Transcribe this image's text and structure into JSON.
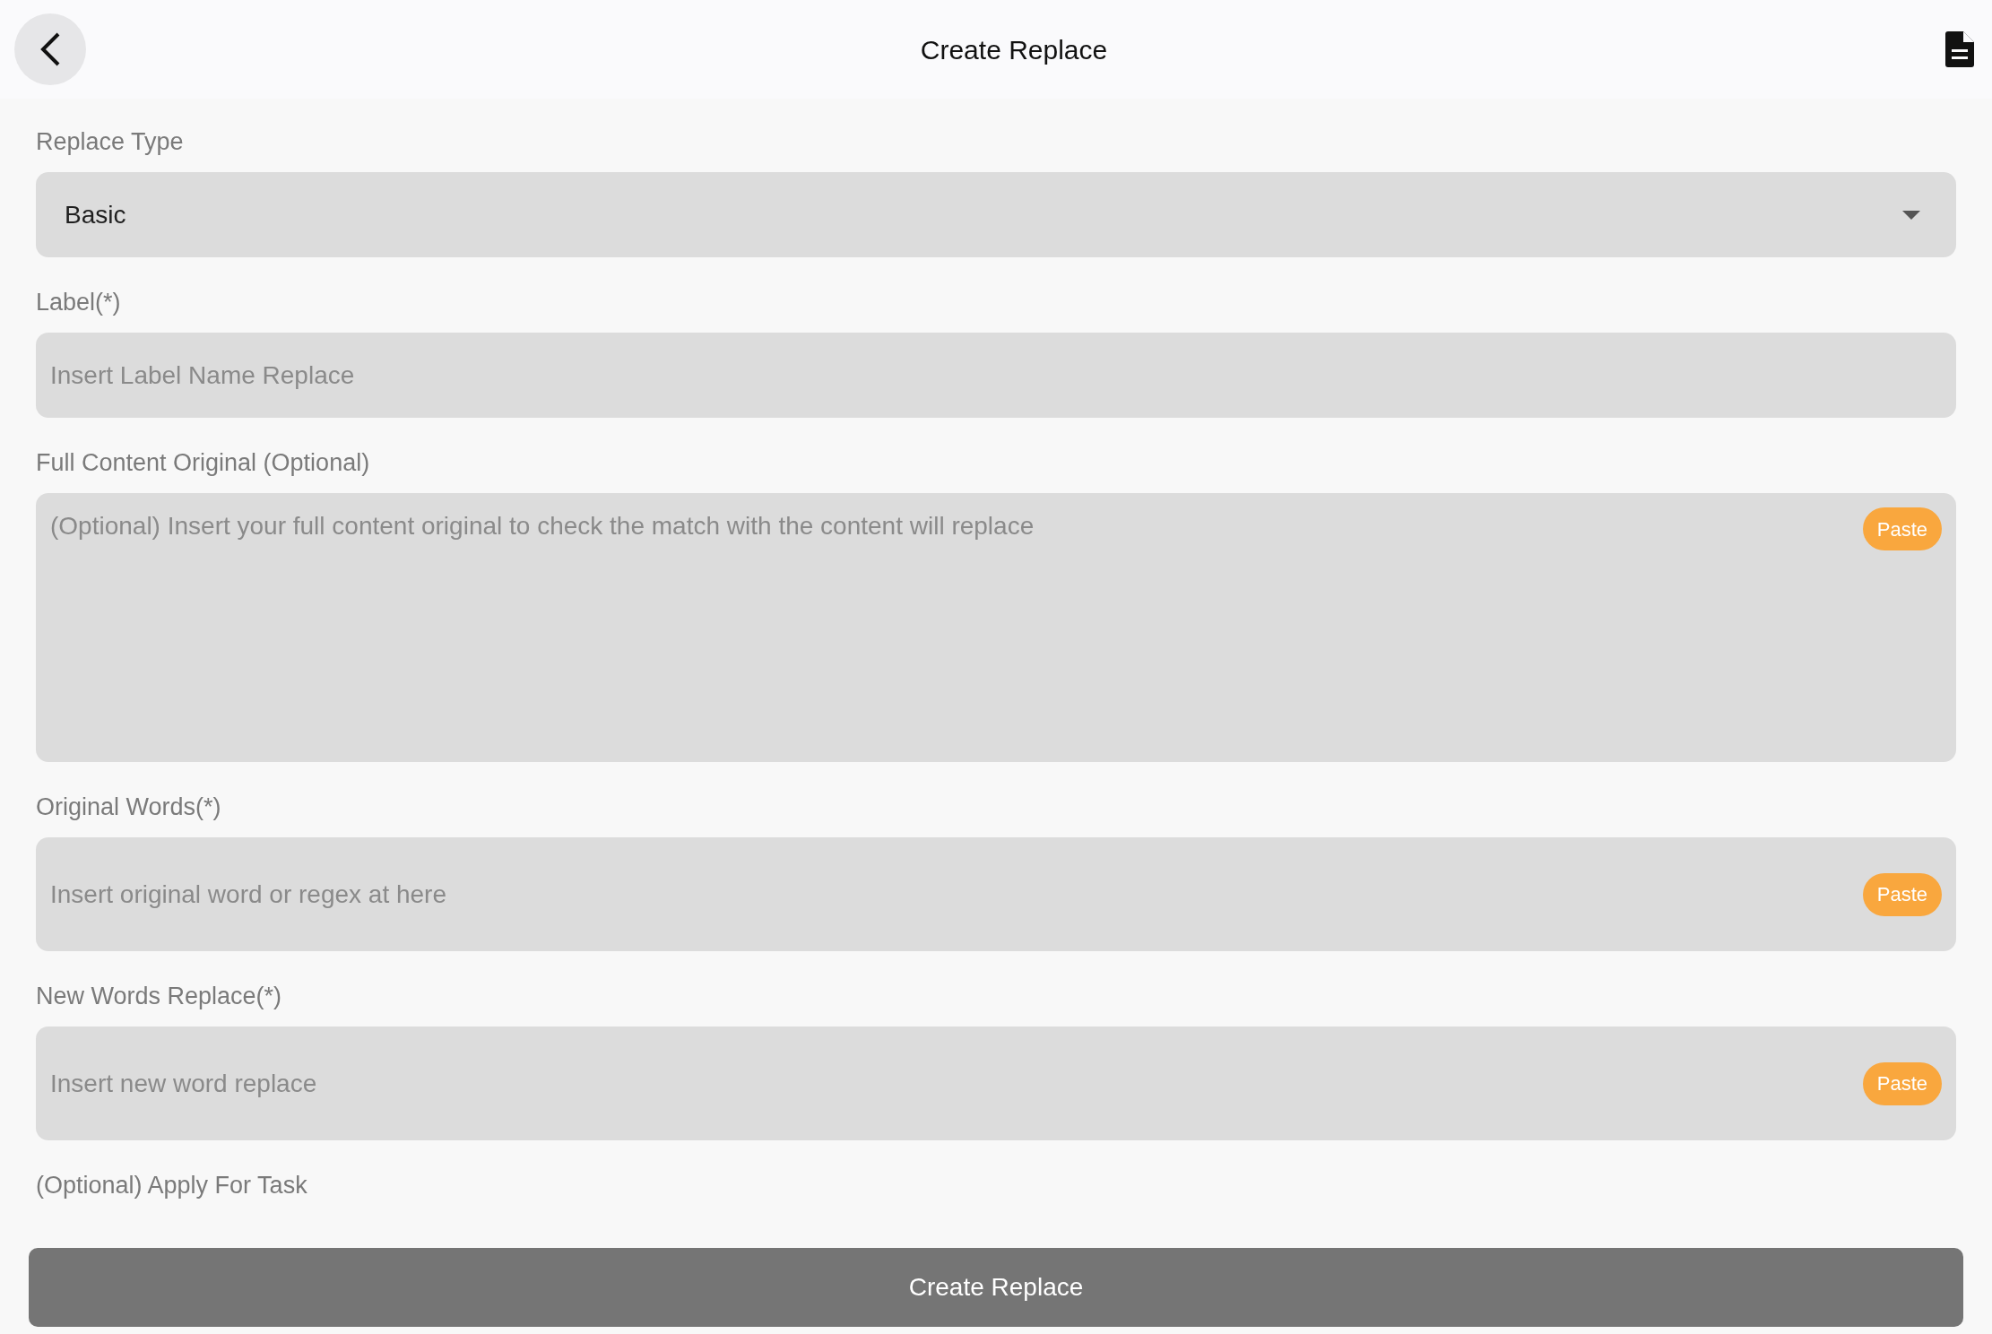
{
  "header": {
    "title": "Create Replace"
  },
  "fields": [
    {
      "kind": "select",
      "label": "Replace Type",
      "value": "Basic"
    },
    {
      "kind": "input",
      "label": "Label(*)",
      "placeholder": "Insert Label Name Replace"
    },
    {
      "kind": "textarea",
      "label": "Full Content Original (Optional)",
      "placeholder": "(Optional) Insert your full content original to check the match with the content will replace",
      "paste": "Paste"
    },
    {
      "kind": "input",
      "label": "Original Words(*)",
      "placeholder": "Insert original word or regex at here",
      "paste": "Paste"
    },
    {
      "kind": "input",
      "label": "New Words Replace(*)",
      "placeholder": "Insert new word replace",
      "paste": "Paste"
    }
  ],
  "apply_label": "(Optional) Apply For Task",
  "submit": "Create Replace"
}
